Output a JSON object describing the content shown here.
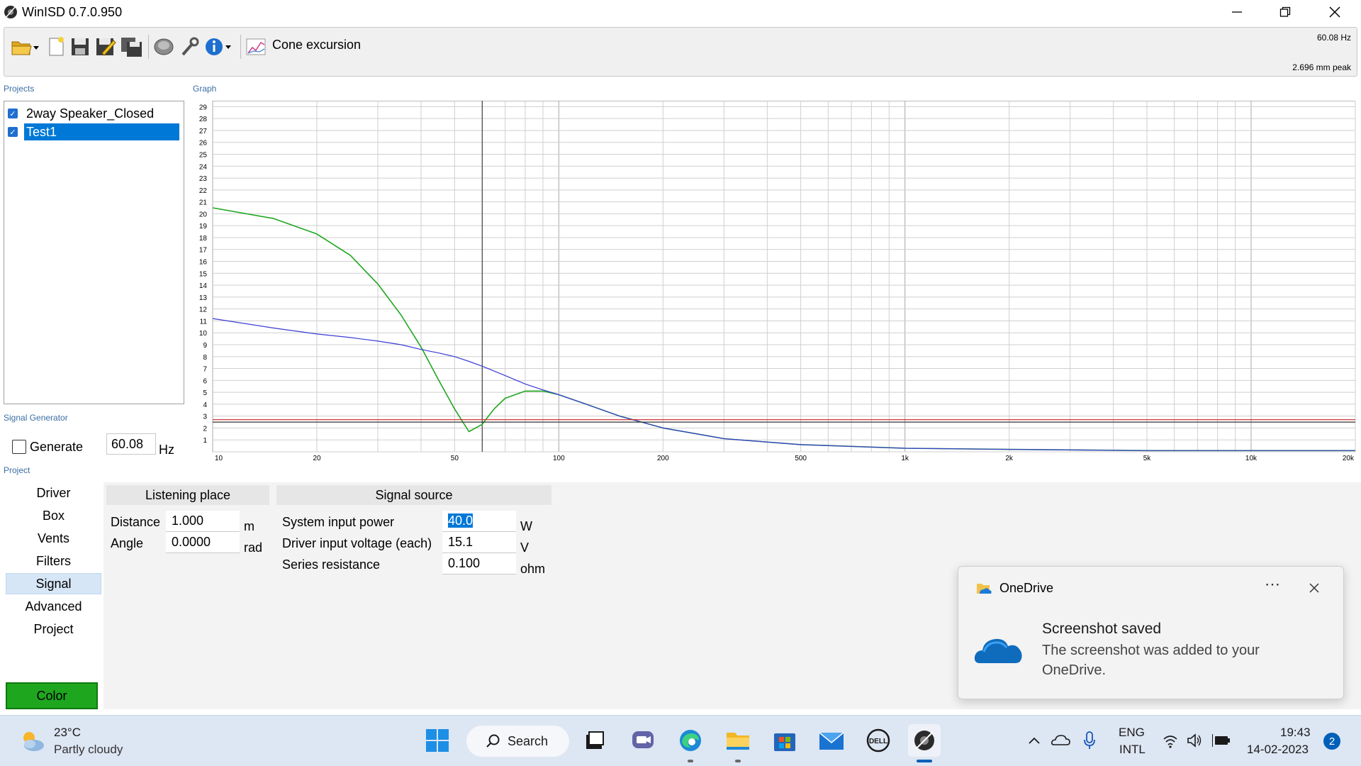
{
  "window": {
    "title": "WinISD 0.7.0.950"
  },
  "toolbar": {
    "icons": [
      "open-folder-icon",
      "new-document-icon",
      "save-icon",
      "save-as-icon",
      "save-all-icon",
      "driver-icon",
      "tools-icon",
      "info-icon",
      "graph-icon"
    ],
    "graph_type": "Cone excursion",
    "readout_freq": "60.08 Hz",
    "readout_value": "2.696 mm peak"
  },
  "sections": {
    "projects": "Projects",
    "graph": "Graph",
    "signal_generator": "Signal Generator",
    "project": "Project"
  },
  "projects": [
    {
      "name": "2way Speaker_Closed",
      "checked": true,
      "selected": false
    },
    {
      "name": "Test1",
      "checked": true,
      "selected": true
    }
  ],
  "chart_data": {
    "type": "line",
    "xscale": "log",
    "xlim": [
      10,
      20000
    ],
    "ylim": [
      0,
      29
    ],
    "x_tick_labels": [
      "10",
      "20",
      "50",
      "100",
      "200",
      "500",
      "1k",
      "2k",
      "5k",
      "10k",
      "20k"
    ],
    "x_tick_values": [
      10,
      20,
      50,
      100,
      200,
      500,
      1000,
      2000,
      5000,
      10000,
      20000
    ],
    "y_tick_labels": [
      "1",
      "2",
      "3",
      "4",
      "5",
      "6",
      "7",
      "8",
      "9",
      "10",
      "11",
      "12",
      "13",
      "14",
      "15",
      "16",
      "17",
      "18",
      "19",
      "20",
      "21",
      "22",
      "23",
      "24",
      "25",
      "26",
      "27",
      "28",
      "29"
    ],
    "cursor_x": 60.08,
    "grid": true,
    "series": [
      {
        "color": "#1fa61f",
        "x": [
          10,
          15,
          20,
          25,
          30,
          35,
          40,
          45,
          50,
          55,
          60,
          65,
          70,
          80,
          90,
          100,
          120,
          150,
          200,
          300,
          500,
          1000,
          2000,
          5000,
          20000
        ],
        "y": [
          20.5,
          19.6,
          18.3,
          16.5,
          14.1,
          11.5,
          8.8,
          6.0,
          3.6,
          1.7,
          2.3,
          3.6,
          4.5,
          5.1,
          5.1,
          4.8,
          4.0,
          3.0,
          2.0,
          1.1,
          0.6,
          0.3,
          0.2,
          0.1,
          0.1
        ]
      },
      {
        "color": "#3b3bd6",
        "x": [
          10,
          15,
          20,
          25,
          30,
          35,
          40,
          45,
          50,
          55,
          60,
          70,
          80,
          90,
          100,
          120,
          150,
          200,
          300,
          500,
          1000,
          2000,
          5000,
          20000
        ],
        "y": [
          11.2,
          10.4,
          9.9,
          9.6,
          9.3,
          9.0,
          8.6,
          8.3,
          8.0,
          7.6,
          7.2,
          6.4,
          5.7,
          5.2,
          4.8,
          4.0,
          3.0,
          2.0,
          1.1,
          0.6,
          0.3,
          0.2,
          0.1,
          0.1
        ]
      },
      {
        "color": "#cc2222",
        "x": [
          10,
          20000
        ],
        "y": [
          2.7,
          2.7
        ]
      },
      {
        "color": "#333333",
        "x": [
          10,
          20000
        ],
        "y": [
          2.5,
          2.5
        ]
      }
    ]
  },
  "signal_generator": {
    "generate_label": "Generate",
    "checked": false,
    "frequency": "60.08",
    "unit": "Hz"
  },
  "nav": {
    "items": [
      "Driver",
      "Box",
      "Vents",
      "Filters",
      "Signal",
      "Advanced",
      "Project"
    ],
    "active": "Signal",
    "color_label": "Color",
    "color_value": "#1fa61f"
  },
  "listening_place": {
    "title": "Listening place",
    "distance_label": "Distance",
    "distance_value": "1.000",
    "distance_unit": "m",
    "angle_label": "Angle",
    "angle_value": "0.0000",
    "angle_unit": "rad"
  },
  "signal_source": {
    "title": "Signal source",
    "power_label": "System input power",
    "power_value": "40.0",
    "power_unit": "W",
    "voltage_label": "Driver input voltage (each)",
    "voltage_value": "15.1",
    "voltage_unit": "V",
    "resistance_label": "Series resistance",
    "resistance_value": "0.100",
    "resistance_unit": "ohm"
  },
  "notification": {
    "app": "OneDrive",
    "title": "Screenshot saved",
    "body": "The screenshot was added to your OneDrive."
  },
  "taskbar": {
    "temperature": "23°C",
    "weather": "Partly cloudy",
    "search_label": "Search",
    "apps": [
      "start-icon",
      "task-view-icon",
      "teams-icon",
      "edge-icon",
      "file-explorer-icon",
      "store-icon",
      "mail-icon",
      "dell-icon",
      "winisd-icon"
    ],
    "language_line1": "ENG",
    "language_line2": "INTL",
    "time": "19:43",
    "date": "14-02-2023",
    "notification_count": "2"
  }
}
